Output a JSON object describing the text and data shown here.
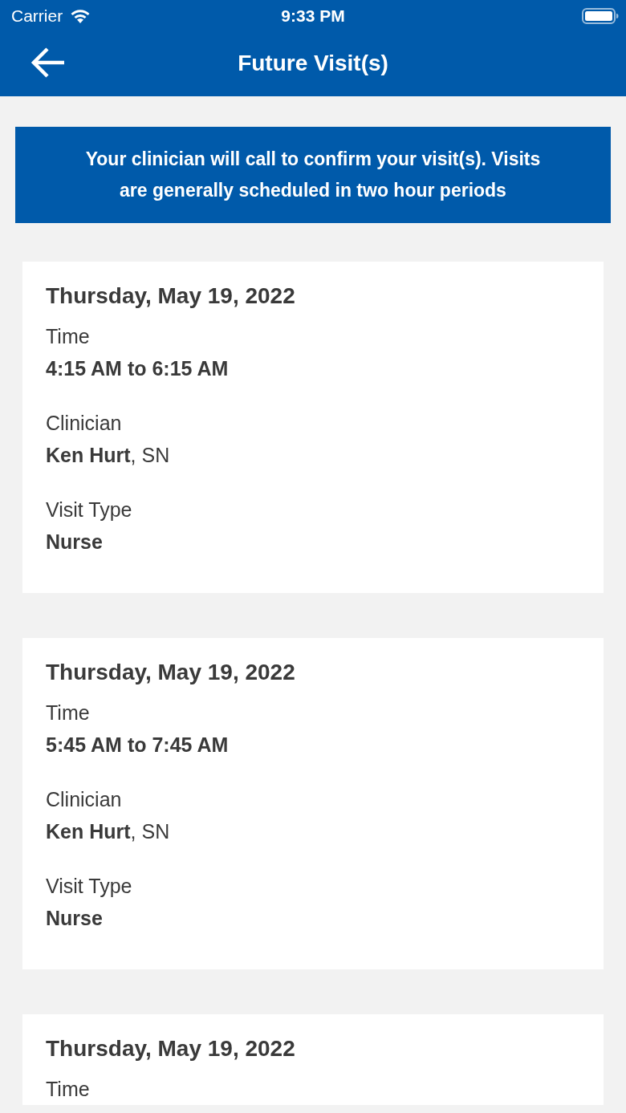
{
  "status_bar": {
    "carrier": "Carrier",
    "time": "9:33 PM"
  },
  "header": {
    "title": "Future Visit(s)"
  },
  "banner": {
    "text": "Your clinician will call to confirm your visit(s). Visits are generally scheduled in two hour periods"
  },
  "visits": [
    {
      "date": "Thursday, May 19, 2022",
      "fields": [
        {
          "label": "Time",
          "kind": "bold",
          "value": "4:15 AM to 6:15 AM"
        },
        {
          "label": "Clinician",
          "kind": "rich",
          "value": "**Ken Hurt**, SN"
        },
        {
          "label": "Visit Type",
          "kind": "bold",
          "value": "Nurse"
        }
      ]
    },
    {
      "date": "Thursday, May 19, 2022",
      "fields": [
        {
          "label": "Time",
          "kind": "bold",
          "value": "5:45 AM to 7:45 AM"
        },
        {
          "label": "Clinician",
          "kind": "rich",
          "value": "**Ken Hurt**, SN"
        },
        {
          "label": "Visit Type",
          "kind": "bold",
          "value": "Nurse"
        }
      ]
    },
    {
      "date": "Thursday, May 19, 2022",
      "fields": [
        {
          "label": "Time"
        }
      ]
    }
  ]
}
